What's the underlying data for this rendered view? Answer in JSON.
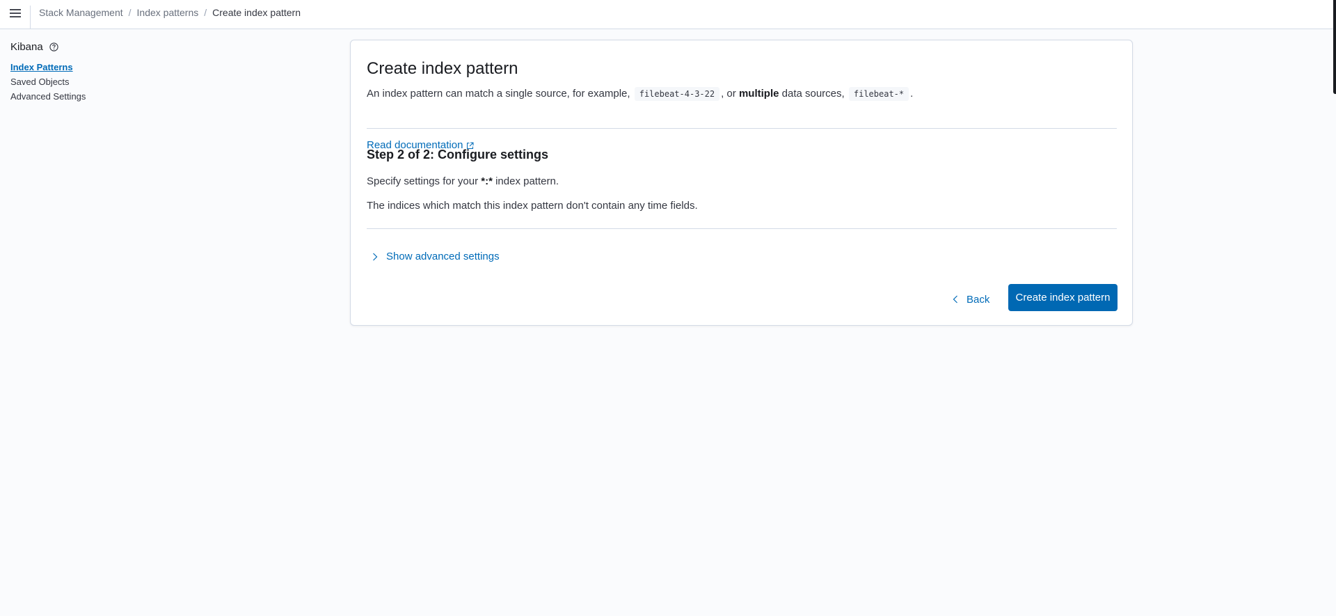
{
  "header": {
    "menu_icon": "hamburger-menu-icon",
    "breadcrumbs": [
      {
        "label": "Stack Management"
      },
      {
        "label": "Index patterns"
      },
      {
        "label": "Create index pattern"
      }
    ],
    "separator": "/"
  },
  "sidenav": {
    "title": "Kibana",
    "help_icon": "question-circle-icon",
    "items": [
      {
        "label": "Index Patterns",
        "active": true
      },
      {
        "label": "Saved Objects",
        "active": false
      },
      {
        "label": "Advanced Settings",
        "active": false
      }
    ]
  },
  "panel": {
    "title": "Create index pattern",
    "desc": {
      "part1": "An index pattern can match a single source, for example,",
      "code1": "filebeat-4-3-22",
      "part2": ", or",
      "bold": "multiple",
      "part3": "data sources,",
      "code2": "filebeat-*",
      "part4": "."
    },
    "read_doc": "Read documentation",
    "step_title": "Step 2 of 2: Configure settings",
    "step_text1_pre": "Specify settings for your",
    "step_text1_pattern": "*:*",
    "step_text1_post": "index pattern.",
    "step_text2": "The indices which match this index pattern don't contain any time fields.",
    "advanced_toggle": "Show advanced settings",
    "back_label": "Back",
    "create_label": "Create index pattern"
  },
  "colors": {
    "link": "#006bb8",
    "primary_button": "#0068b3",
    "background": "#fafbfd",
    "border": "#d3dae6"
  }
}
